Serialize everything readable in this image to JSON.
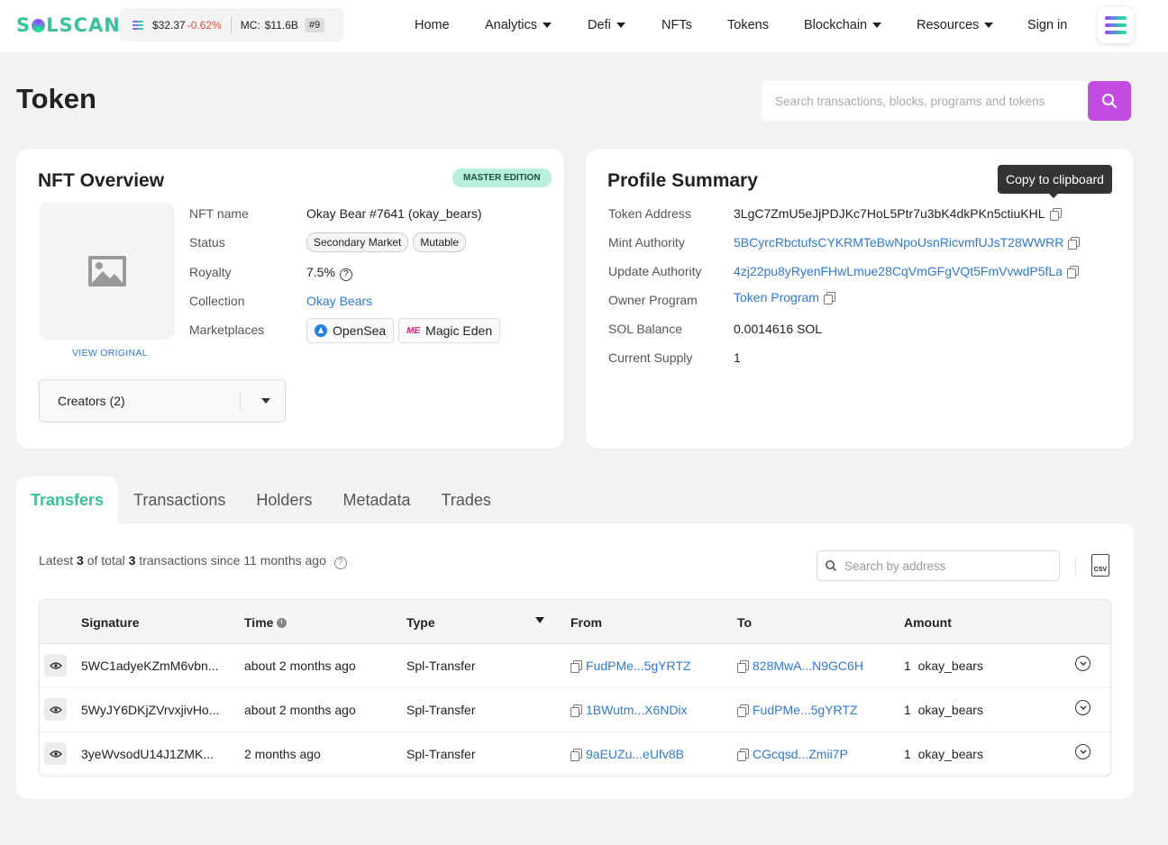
{
  "header": {
    "logo": "SOLSCAN",
    "price": "$32.37",
    "change": "-0.62%",
    "mc_label": "MC:",
    "mc_value": "$11.6B",
    "rank": "#9",
    "nav": [
      "Home",
      "Analytics",
      "Defi",
      "NFTs",
      "Tokens",
      "Blockchain",
      "Resources",
      "Sign in"
    ]
  },
  "page": {
    "title": "Token",
    "search_placeholder": "Search transactions, blocks, programs and tokens"
  },
  "nft_overview": {
    "title": "NFT Overview",
    "badge": "MASTER EDITION",
    "view_original": "VIEW ORIGINAL",
    "creators": "Creators (2)",
    "labels": {
      "name": "NFT name",
      "status": "Status",
      "royalty": "Royalty",
      "collection": "Collection",
      "marketplaces": "Marketplaces"
    },
    "name": "Okay Bear #7641 (okay_bears)",
    "status": [
      "Secondary Market",
      "Mutable"
    ],
    "royalty": "7.5%",
    "collection": "Okay Bears",
    "marketplaces": [
      "OpenSea",
      "Magic Eden"
    ]
  },
  "profile": {
    "title": "Profile Summary",
    "tooltip": "Copy to clipboard",
    "labels": {
      "token": "Token Address",
      "mint": "Mint Authority",
      "update": "Update Authority",
      "owner": "Owner Program",
      "sol": "SOL Balance",
      "supply": "Current Supply"
    },
    "token_address": "3LgC7ZmU5eJjPDJKc7HoL5Ptr7u3bK4dkPKn5ctiuKHL",
    "mint_authority": "5BCyrcRbctufsCYKRMTeBwNpoUsnRicvmfUJsT28WWRR",
    "update_authority": "4zj22pu8yRyenFHwLmue28CqVmGFgVQt5FmVvwdP5fLa",
    "owner_program": "Token Program",
    "sol_balance": "0.0014616 SOL",
    "current_supply": "1"
  },
  "tabs": [
    "Transfers",
    "Transactions",
    "Holders",
    "Metadata",
    "Trades"
  ],
  "transfers": {
    "summary_pre": "Latest",
    "count": "3",
    "summary_mid": "of total",
    "total": "3",
    "summary_post": "transactions since 11 months ago",
    "search_placeholder": "Search by address",
    "csv": "CSV",
    "columns": [
      "Signature",
      "Time",
      "Type",
      "From",
      "To",
      "Amount"
    ],
    "rows": [
      {
        "signature": "5WC1adyeKZmM6vbn...",
        "time": "about 2 months ago",
        "type": "Spl-Transfer",
        "from": "FudPMe...5gYRTZ",
        "to": "828MwA...N9GC6H",
        "amount": "1",
        "token": "okay_bears"
      },
      {
        "signature": "5WyJY6DKjZVrvxjivHo...",
        "time": "about 2 months ago",
        "type": "Spl-Transfer",
        "from": "1BWutm...X6NDix",
        "to": "FudPMe...5gYRTZ",
        "amount": "1",
        "token": "okay_bears"
      },
      {
        "signature": "3yeWvsodU14J1ZMK...",
        "time": "2 months ago",
        "type": "Spl-Transfer",
        "from": "9aEUZu...eUfv8B",
        "to": "CGcqsd...Zmii7P",
        "amount": "1",
        "token": "okay_bears"
      }
    ]
  }
}
